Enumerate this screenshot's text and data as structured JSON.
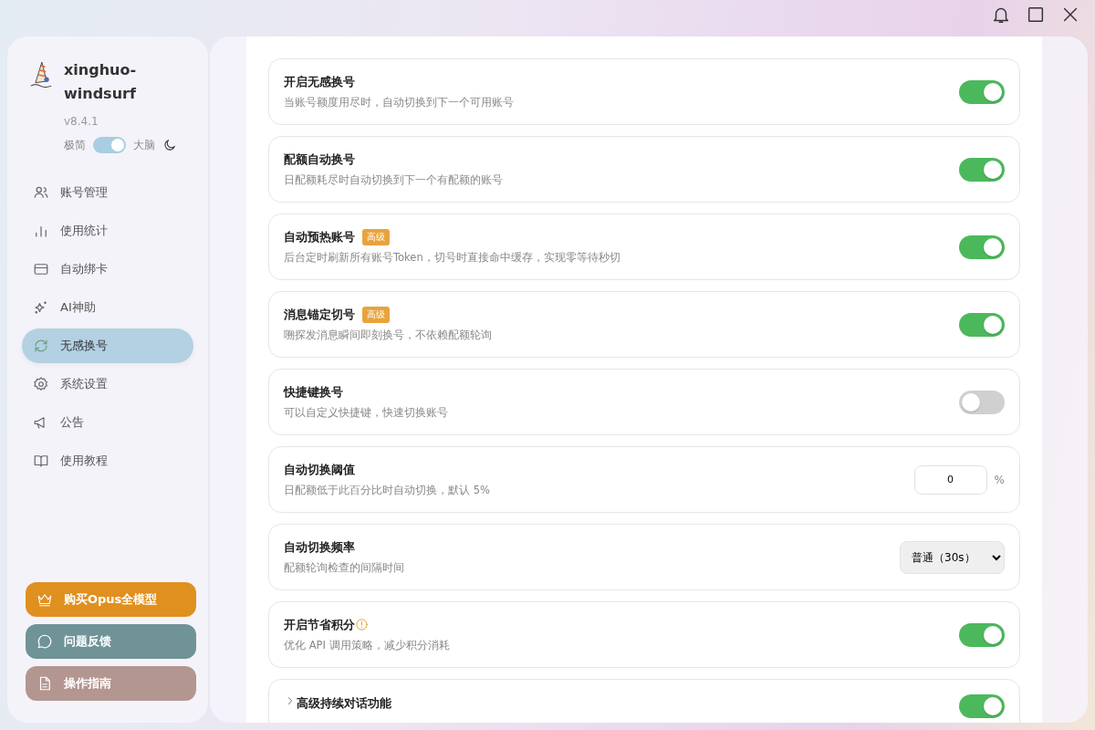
{
  "app": {
    "name": "xinghuo-windsurf",
    "version": "v8.4.1",
    "mode_left": "极简",
    "mode_right": "大脑",
    "mode_on": true
  },
  "nav": [
    {
      "label": "账号管理",
      "selected": false
    },
    {
      "label": "使用统计",
      "selected": false
    },
    {
      "label": "自动绑卡",
      "selected": false
    },
    {
      "label": "AI神助",
      "selected": false
    },
    {
      "label": "无感换号",
      "selected": true
    },
    {
      "label": "系统设置",
      "selected": false
    },
    {
      "label": "公告",
      "selected": false
    },
    {
      "label": "使用教程",
      "selected": false
    }
  ],
  "actions": [
    {
      "label": "购买Opus全模型",
      "color": "#e0901f"
    },
    {
      "label": "问题反馈",
      "color": "#6f9397"
    },
    {
      "label": "操作指南",
      "color": "#b39690"
    }
  ],
  "settings": [
    {
      "kind": "toggle",
      "title": "开启无感换号",
      "desc": "当账号额度用尽时，自动切换到下一个可用账号",
      "on": true
    },
    {
      "kind": "toggle",
      "title": "配额自动换号",
      "desc": "日配额耗尽时自动切换到下一个有配额的账号",
      "on": true
    },
    {
      "kind": "toggle",
      "title": "自动预热账号",
      "badge": "高级",
      "desc": "后台定时刷新所有账号Token，切号时直接命中缓存，实现零等待秒切",
      "on": true
    },
    {
      "kind": "toggle",
      "title": "消息锚定切号",
      "badge": "高级",
      "desc": "嗍探发消息瞬间即刻换号，不依赖配额轮询",
      "on": true
    },
    {
      "kind": "toggle",
      "title": "快捷键换号",
      "desc": "可以自定义快捷键，快速切换账号",
      "on": false
    },
    {
      "kind": "number",
      "title": "自动切换阈值",
      "desc": "日配额低于此百分比时自动切换，默认 5%",
      "value": "0",
      "unit": "%"
    },
    {
      "kind": "select",
      "title": "自动切换频率",
      "desc": "配额轮询检查的间隔时间",
      "value": "普通（30s）"
    },
    {
      "kind": "toggle",
      "title": "开启节省积分",
      "info": true,
      "desc": "优化 API 调用策略，减少积分消耗",
      "on": true
    },
    {
      "kind": "toggle",
      "title": "高级持续对话功能",
      "expandable": true,
      "on": true
    }
  ]
}
